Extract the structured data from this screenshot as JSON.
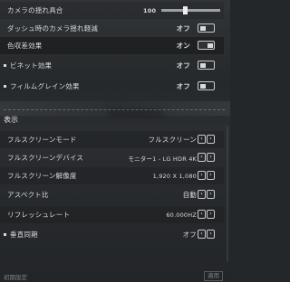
{
  "camera_shake": {
    "label": "カメラの揺れ具合",
    "value": "100",
    "fraction": 0.4
  },
  "dash_shake": {
    "label": "ダッシュ時のカメラ揺れ軽減",
    "value": "オフ",
    "on": false
  },
  "chromatic": {
    "label": "色収差効果",
    "value": "オン",
    "on": true
  },
  "vignette": {
    "label": "ビネット効果",
    "value": "オフ",
    "on": false
  },
  "film_grain": {
    "label": "フィルムグレイン効果",
    "value": "オフ",
    "on": false
  },
  "section": {
    "title": "表示"
  },
  "fullscreen_mode": {
    "label": "フルスクリーンモード",
    "value": "フルスクリーン"
  },
  "fullscreen_device": {
    "label": "フルスクリーンデバイス",
    "value": "モニター1 - LG HDR 4K"
  },
  "fullscreen_resolution": {
    "label": "フルスクリーン解像度",
    "value": "1,920 X 1,080"
  },
  "aspect_ratio": {
    "label": "アスペクト比",
    "value": "自動"
  },
  "refresh_rate": {
    "label": "リフレッシュレート",
    "value": "60.000HZ"
  },
  "vsync": {
    "label": "垂直同期",
    "value": "オフ"
  },
  "footer": {
    "left": "初期設定",
    "right": "適用"
  },
  "icons": {
    "left_arrow": "chevron-left-icon",
    "right_arrow": "chevron-right-icon"
  }
}
